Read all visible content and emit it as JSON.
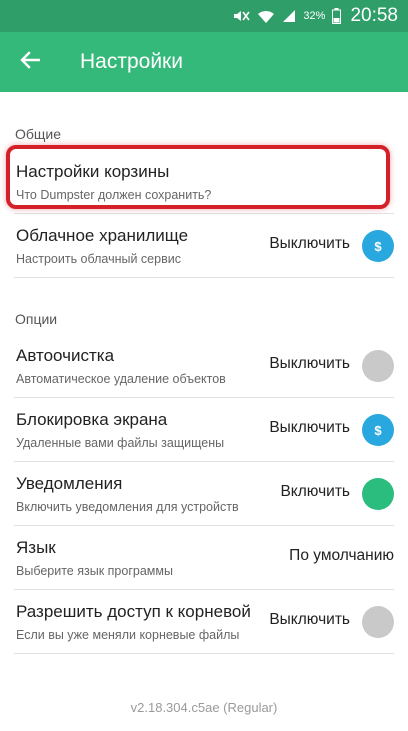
{
  "status_bar": {
    "battery": "32%",
    "time": "20:58",
    "icons": [
      "mute-icon",
      "wifi-icon",
      "signal-icon",
      "battery-icon"
    ]
  },
  "app_bar": {
    "title": "Настройки",
    "back_icon": "arrow-left-icon"
  },
  "colors": {
    "status_bar": "#2f9e69",
    "app_bar": "#35b97a",
    "accent_blue": "#29a8e0",
    "accent_green": "#2bbd7e",
    "inactive_gray": "#c9c9c9",
    "highlight_red": "#d42028"
  },
  "sections": {
    "general": {
      "header": "Общие",
      "items": [
        {
          "title": "Настройки корзины",
          "subtitle": "Что Dumpster должен сохранить?"
        },
        {
          "title": "Облачное хранилище",
          "subtitle": "Настроить облачный сервис",
          "value": "Выключить",
          "indicator": "blue-dollar"
        }
      ]
    },
    "options": {
      "header": "Опции",
      "items": [
        {
          "title": "Автоочистка",
          "subtitle": "Автоматическое удаление объектов",
          "value": "Выключить",
          "indicator": "gray"
        },
        {
          "title": "Блокировка экрана",
          "subtitle": "Удаленные вами файлы защищены",
          "value": "Выключить",
          "indicator": "blue-dollar"
        },
        {
          "title": "Уведомления",
          "subtitle": "Включить уведомления для устройств",
          "value": "Включить",
          "indicator": "green"
        },
        {
          "title": "Язык",
          "subtitle": "Выберите язык программы",
          "value": "По умолчанию"
        },
        {
          "title": "Разрешить доступ к корневой",
          "subtitle": "Если вы уже меняли корневые файлы",
          "value": "Выключить",
          "indicator": "gray"
        }
      ]
    }
  },
  "premium_symbol": "$",
  "version": "v2.18.304.c5ae (Regular)"
}
